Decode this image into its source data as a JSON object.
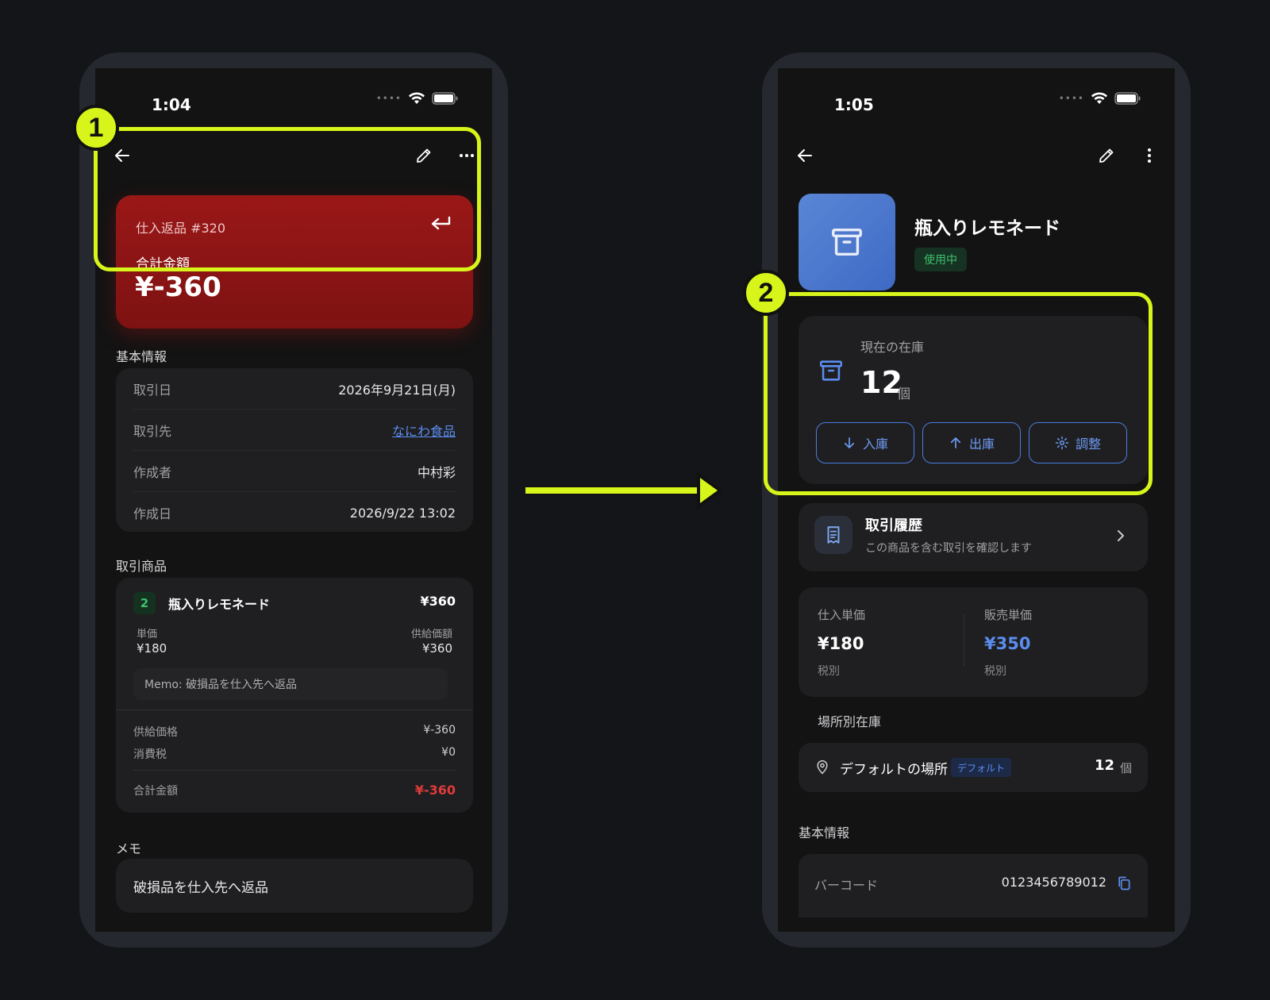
{
  "left": {
    "status": {
      "time": "1:04"
    },
    "hero": {
      "id": "仕入返品 #320",
      "label": "合計金額",
      "amount": "¥-360"
    },
    "basic": {
      "title": "基本情報",
      "rows": [
        {
          "k": "取引日",
          "v": "2026年9月21日(月)"
        },
        {
          "k": "取引先",
          "v": "なにわ食品"
        },
        {
          "k": "作成者",
          "v": "中村彩"
        },
        {
          "k": "作成日",
          "v": "2026/9/22 13:02"
        }
      ]
    },
    "items": {
      "title": "取引商品",
      "item": {
        "qty": "2",
        "name": "瓶入りレモネード",
        "price": "¥360",
        "unit_label": "単価",
        "unit_value": "¥180",
        "supply_label": "供給価額",
        "supply_value": "¥360",
        "memo": "Memo: 破損品を仕入先へ返品"
      },
      "summary": {
        "supply_label": "供給価格",
        "supply_value": "¥-360",
        "tax_label": "消費税",
        "tax_value": "¥0",
        "total_label": "合計金額",
        "total_value": "¥-360"
      }
    },
    "memo": {
      "title": "メモ",
      "text": "破損品を仕入先へ返品"
    }
  },
  "right": {
    "status": {
      "time": "1:05"
    },
    "product": {
      "name": "瓶入りレモネード",
      "status": "使用中"
    },
    "stock": {
      "label": "現在の在庫",
      "value": "12",
      "unit": "個",
      "buttons": [
        {
          "label": "入庫",
          "icon": "arrow-down-icon"
        },
        {
          "label": "出庫",
          "icon": "arrow-up-icon"
        },
        {
          "label": "調整",
          "icon": "gear-icon"
        }
      ]
    },
    "history": {
      "title": "取引履歴",
      "subtitle": "この商品を含む取引を確認します"
    },
    "prices": {
      "purchase_label": "仕入単価",
      "purchase_value": "¥180",
      "purchase_tax": "税別",
      "sale_label": "販売単価",
      "sale_value": "¥350",
      "sale_tax": "税別"
    },
    "locations": {
      "title": "場所別在庫",
      "item": {
        "name": "デフォルトの場所",
        "badge": "デフォルト",
        "qty": "12",
        "unit": "個"
      }
    },
    "basic": {
      "title": "基本情報",
      "barcode_label": "バーコード",
      "barcode_value": "0123456789012"
    }
  },
  "annotations": {
    "marker1": "1",
    "marker2": "2"
  },
  "colors": {
    "highlight": "#d7f51a",
    "hero_red": "#8e1414",
    "accent_blue": "#5b8def",
    "status_green": "#3fc06c"
  }
}
